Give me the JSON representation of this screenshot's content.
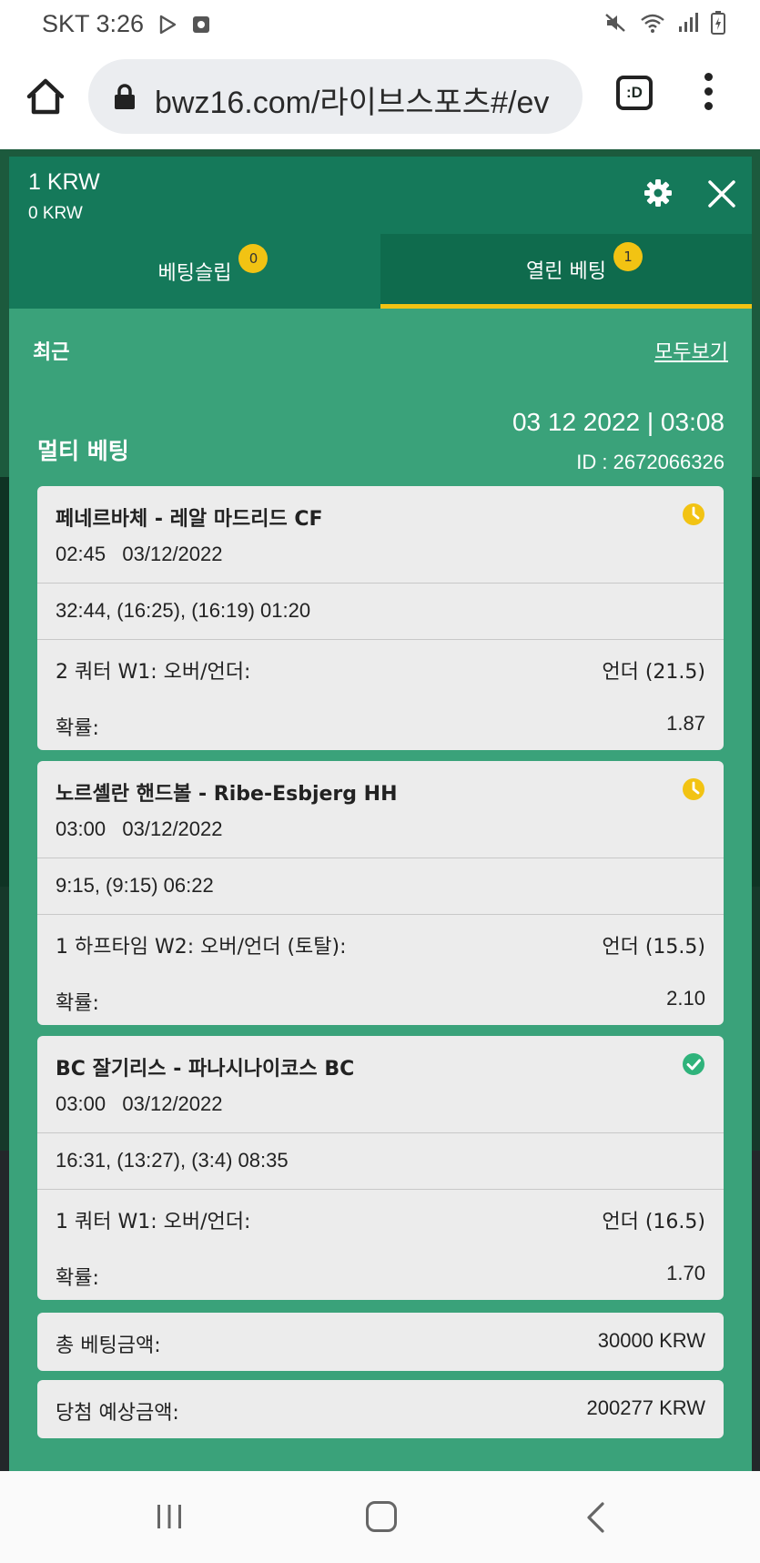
{
  "status_bar": {
    "carrier_time": "SKT 3:26",
    "icons": [
      "play-store-icon",
      "screen-record-icon",
      "mute-icon",
      "wifi-icon",
      "signal-icon",
      "battery-icon"
    ]
  },
  "browser": {
    "url": "bwz16.com/라이브스포츠#/ev",
    "tabs_label": ":D"
  },
  "panel": {
    "balance_main": "1 KRW",
    "balance_sub": "0 KRW",
    "tabs": [
      {
        "label": "베팅슬립",
        "badge": "0",
        "active": false
      },
      {
        "label": "열린 베팅",
        "badge": "1",
        "active": true
      }
    ],
    "recent": {
      "title": "최근",
      "view_all": "모두보기"
    },
    "bet": {
      "type": "멀티 베팅",
      "date": "03 12 2022 | 03:08",
      "id": "ID :  2672066326",
      "matches": [
        {
          "name": "페네르바체 - 레알 마드리드 CF",
          "time": "02:45   03/12/2022",
          "score": "32:44, (16:25), (16:19) 01:20",
          "market": "2 쿼터 W1: 오버/언더:",
          "pick": "언더 (21.5)",
          "odds_label": "확률:",
          "odds": "1.87",
          "status": "pending"
        },
        {
          "name": "노르셸란 핸드볼 - Ribe-Esbjerg HH",
          "time": "03:00   03/12/2022",
          "score": "9:15, (9:15) 06:22",
          "market": "1 하프타임 W2: 오버/언더 (토탈):",
          "pick": "언더 (15.5)",
          "odds_label": "확률:",
          "odds": "2.10",
          "status": "pending"
        },
        {
          "name": "BC 잘기리스 - 파나시나이코스 BC",
          "time": "03:00   03/12/2022",
          "score": "16:31, (13:27), (3:4) 08:35",
          "market": "1 쿼터 W1: 오버/언더:",
          "pick": "언더 (16.5)",
          "odds_label": "확률:",
          "odds": "1.70",
          "status": "won"
        }
      ],
      "total_label": "총 베팅금액:",
      "total_value": "30000 KRW",
      "payout_label": "당첨 예상금액:",
      "payout_value": "200277 KRW"
    }
  },
  "colors": {
    "header_green": "#15795a",
    "panel_green": "#3aa27a",
    "accent_yellow": "#f2c313",
    "won_green": "#2fb37b"
  }
}
